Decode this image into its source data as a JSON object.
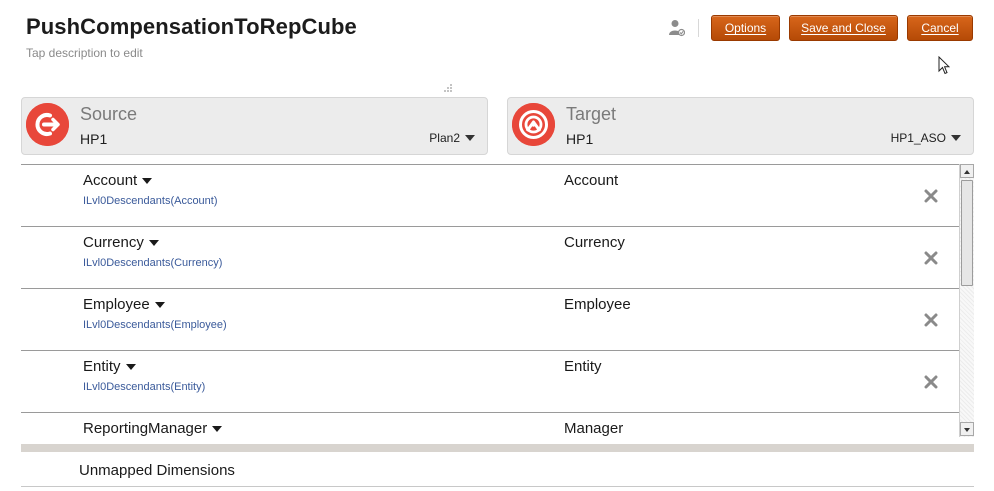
{
  "header": {
    "title": "PushCompensationToRepCube",
    "description_placeholder": "Tap description to edit"
  },
  "toolbar": {
    "options_label": "Options",
    "save_close_label": "Save and Close",
    "cancel_label": "Cancel"
  },
  "source": {
    "label": "Source",
    "application": "HP1",
    "cube": "Plan2"
  },
  "target": {
    "label": "Target",
    "application": "HP1",
    "cube": "HP1_ASO"
  },
  "mappings": [
    {
      "source_dimension": "Account",
      "source_selection": "ILvl0Descendants(Account)",
      "target_dimension": "Account"
    },
    {
      "source_dimension": "Currency",
      "source_selection": "ILvl0Descendants(Currency)",
      "target_dimension": "Currency"
    },
    {
      "source_dimension": "Employee",
      "source_selection": "ILvl0Descendants(Employee)",
      "target_dimension": "Employee"
    },
    {
      "source_dimension": "Entity",
      "source_selection": "ILvl0Descendants(Entity)",
      "target_dimension": "Entity"
    },
    {
      "source_dimension": "ReportingManager",
      "source_selection": "",
      "target_dimension": "Manager"
    }
  ],
  "unmapped": {
    "label": "Unmapped Dimensions"
  },
  "colors": {
    "accent": "#c85a12",
    "logo": "#e8473a",
    "link": "#3a5a9a"
  },
  "icons": [
    "user-icon",
    "source-icon",
    "target-icon",
    "remove-icon",
    "caret-down-icon",
    "resize-grip-icon",
    "mouse-pointer-icon"
  ]
}
